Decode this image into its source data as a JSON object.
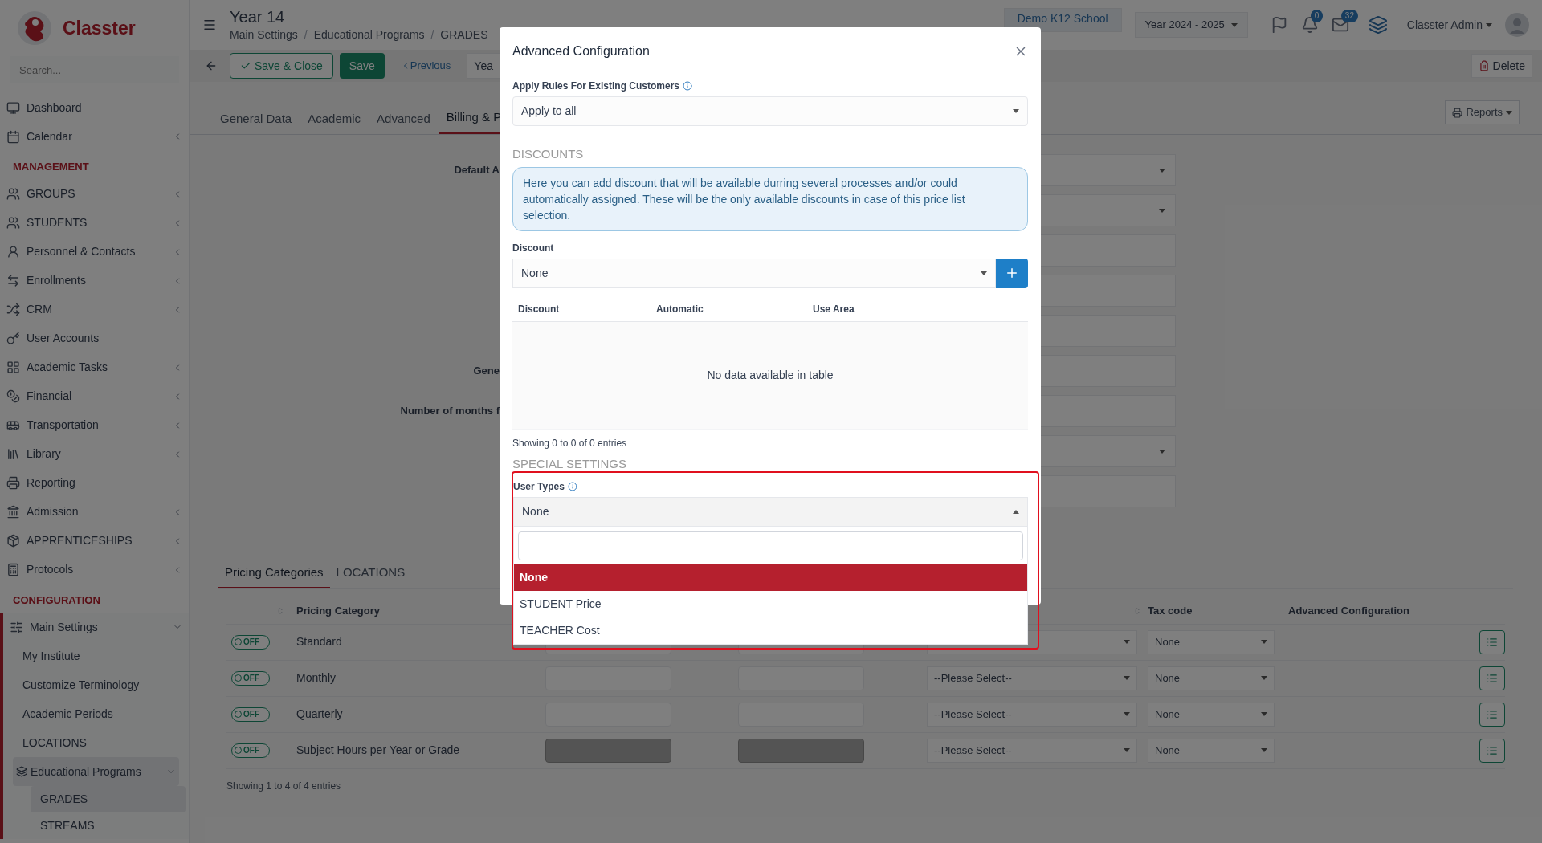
{
  "brand": {
    "name": "Classter"
  },
  "sidebar": {
    "search": {
      "placeholder": "Search..."
    },
    "sections": [
      {
        "items": [
          {
            "label": "Dashboard",
            "kind": "link"
          },
          {
            "label": "Calendar",
            "kind": "group",
            "expanded": false
          }
        ]
      },
      {
        "title": "MANAGEMENT",
        "items": [
          {
            "label": "GROUPS",
            "kind": "group",
            "expanded": false
          },
          {
            "label": "STUDENTS",
            "kind": "group",
            "expanded": false
          },
          {
            "label": "Personnel & Contacts",
            "kind": "group",
            "expanded": false
          },
          {
            "label": "Enrollments",
            "kind": "group",
            "expanded": false
          },
          {
            "label": "CRM",
            "kind": "group",
            "expanded": false
          },
          {
            "label": "User Accounts",
            "kind": "link"
          },
          {
            "label": "Academic Tasks",
            "kind": "group",
            "expanded": false
          },
          {
            "label": "Financial",
            "kind": "group",
            "expanded": false
          },
          {
            "label": "Transportation",
            "kind": "group",
            "expanded": false
          },
          {
            "label": "Library",
            "kind": "group",
            "expanded": false
          },
          {
            "label": "Reporting",
            "kind": "link"
          },
          {
            "label": "Admission",
            "kind": "group",
            "expanded": false
          },
          {
            "label": "APPRENTICESHIPS",
            "kind": "group",
            "expanded": false
          },
          {
            "label": "Protocols",
            "kind": "group",
            "expanded": false
          }
        ]
      },
      {
        "title": "CONFIGURATION",
        "items": [
          {
            "label": "Main Settings",
            "kind": "group",
            "expanded": true,
            "children": [
              {
                "label": "My Institute",
                "kind": "link",
                "selected": false
              },
              {
                "label": "Customize Terminology",
                "kind": "link",
                "selected": false
              },
              {
                "label": "Academic Periods",
                "kind": "link",
                "selected": false
              },
              {
                "label": "LOCATIONS",
                "kind": "link",
                "selected": false
              },
              {
                "label": "Educational Programs",
                "kind": "group",
                "expanded": true,
                "children": [
                  {
                    "label": "GRADES",
                    "selected": true
                  },
                  {
                    "label": "STREAMS",
                    "selected": false
                  }
                ]
              }
            ]
          }
        ]
      }
    ]
  },
  "header": {
    "title": "Year 14",
    "breadcrumb": [
      "Main Settings",
      "Educational Programs",
      "GRADES"
    ],
    "breadcrumb_separator": "/",
    "school": "Demo K12 School",
    "year": "Year 2024 - 2025",
    "notifications": "0",
    "messages": "32",
    "user": "Classter Admin"
  },
  "toolbar": {
    "save_close": "Save & Close",
    "save": "Save",
    "previous": "Previous",
    "field_value": "Yea",
    "delete": "Delete"
  },
  "tabs": [
    {
      "label": "General Data",
      "selected": false
    },
    {
      "label": "Academic",
      "selected": false
    },
    {
      "label": "Advanced",
      "selected": false
    },
    {
      "label": "Billing & P",
      "selected": true
    }
  ],
  "reports": "Reports",
  "form": {
    "fields": [
      {
        "label": "Default A",
        "kind": "select"
      },
      {
        "kind": "select"
      },
      {
        "kind": "input"
      },
      {
        "kind": "input"
      },
      {
        "kind": "input"
      },
      {
        "label": "Gene",
        "kind": "input"
      },
      {
        "label": "Number of months f",
        "kind": "input"
      },
      {
        "kind": "select"
      },
      {
        "kind": "input"
      }
    ]
  },
  "pricing": {
    "tabs": [
      {
        "label": "Pricing Categories",
        "selected": true
      },
      {
        "label": "LOCATIONS",
        "selected": false
      }
    ],
    "columns": {
      "category": "Pricing Category",
      "tax": "Tax code",
      "advanced": "Advanced Configuration"
    },
    "rows": [
      {
        "toggle": "OFF",
        "on": false,
        "category": "Standard",
        "disabled": false,
        "tax": "None"
      },
      {
        "toggle": "OFF",
        "on": false,
        "category": "Monthly",
        "disabled": false,
        "plan": "--Please Select--",
        "tax": "None"
      },
      {
        "toggle": "OFF",
        "on": false,
        "category": "Quarterly",
        "disabled": false,
        "plan": "--Please Select--",
        "tax": "None"
      },
      {
        "toggle": "OFF",
        "on": false,
        "category": "Subject Hours per Year or Grade",
        "disabled": true,
        "plan": "--Please Select--",
        "tax": "None"
      }
    ],
    "footer": "Showing 1 to 4 of 4 entries"
  },
  "modal": {
    "title": "Advanced Configuration",
    "apply_rules": {
      "label": "Apply Rules For Existing Customers",
      "value": "Apply to all"
    },
    "discounts_heading": "DISCOUNTS",
    "info": "Here you can add discount that will be available durring several processes and/or could automatically assigned. These will be the only available discounts in case of this price list selection.",
    "discount": {
      "label": "Discount",
      "value": "None"
    },
    "table": {
      "columns": [
        "Discount",
        "Automatic",
        "Use Area"
      ],
      "empty": "No data available in table",
      "footer": "Showing 0 to 0 of 0 entries"
    },
    "special_heading": "SPECIAL SETTINGS",
    "user_types": {
      "label": "User Types",
      "value": "None",
      "open": true,
      "options": [
        {
          "label": "None",
          "selected": true
        },
        {
          "label": "STUDENT Price",
          "selected": false
        },
        {
          "label": "TEACHER Cost",
          "selected": false
        }
      ]
    }
  }
}
